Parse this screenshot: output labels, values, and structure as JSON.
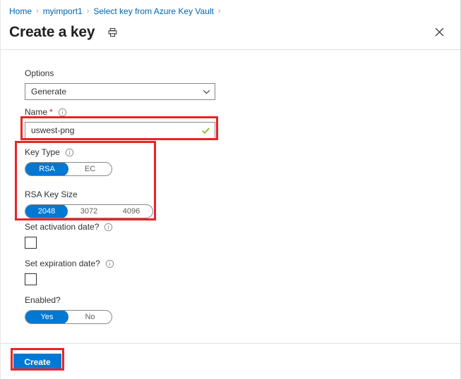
{
  "breadcrumb": {
    "items": [
      {
        "label": "Home"
      },
      {
        "label": "myimport1"
      },
      {
        "label": "Select key from Azure Key Vault"
      }
    ],
    "separator": "›"
  },
  "header": {
    "title": "Create a key",
    "print_icon": "printer-icon",
    "close_icon": "close-icon",
    "close_glyph": "✕"
  },
  "form": {
    "options": {
      "label": "Options",
      "value": "Generate",
      "chevron_icon": "chevron-down-icon"
    },
    "name": {
      "label": "Name",
      "required_marker": "*",
      "info_icon": "info-icon",
      "value": "uswest-png",
      "placeholder": "",
      "valid_icon": "checkmark-icon"
    },
    "key_type": {
      "label": "Key Type",
      "info_icon": "info-icon",
      "options": [
        "RSA",
        "EC"
      ],
      "selected": "RSA"
    },
    "rsa_key_size": {
      "label": "RSA Key Size",
      "options": [
        "2048",
        "3072",
        "4096"
      ],
      "selected": "2048"
    },
    "set_activation_date": {
      "label": "Set activation date?",
      "info_icon": "info-icon",
      "checked": false
    },
    "set_expiration_date": {
      "label": "Set expiration date?",
      "info_icon": "info-icon",
      "checked": false
    },
    "enabled": {
      "label": "Enabled?",
      "options": [
        "Yes",
        "No"
      ],
      "selected": "Yes"
    }
  },
  "footer": {
    "create_label": "Create"
  },
  "colors": {
    "accent_blue": "#0078d4",
    "link_blue": "#0063b1",
    "annotation_red": "#ec2227",
    "valid_green": "#6bb700",
    "required_red": "#a4262c",
    "text": "#323130",
    "border": "#8a8886",
    "divider": "#e1dfdd"
  }
}
